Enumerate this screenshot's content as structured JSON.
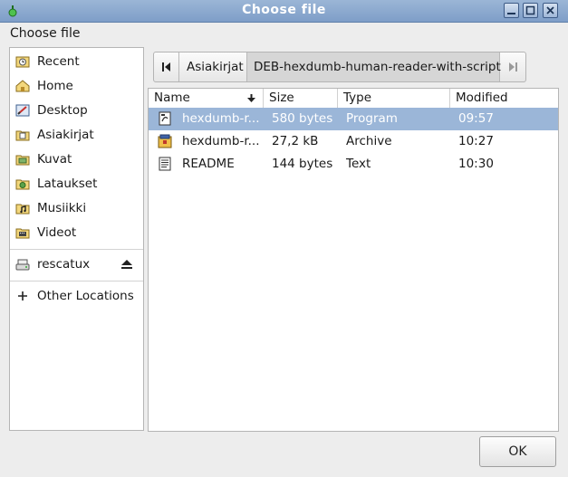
{
  "window": {
    "title": "Choose file"
  },
  "dialog": {
    "header": "Choose file",
    "ok_label": "OK"
  },
  "sidebar": {
    "places": [
      {
        "label": "Recent",
        "icon": "recent-icon"
      },
      {
        "label": "Home",
        "icon": "home-folder-icon"
      },
      {
        "label": "Desktop",
        "icon": "desktop-icon"
      },
      {
        "label": "Asiakirjat",
        "icon": "documents-folder-icon"
      },
      {
        "label": "Kuvat",
        "icon": "pictures-folder-icon"
      },
      {
        "label": "Lataukset",
        "icon": "downloads-folder-icon"
      },
      {
        "label": "Musiikki",
        "icon": "music-folder-icon"
      },
      {
        "label": "Videot",
        "icon": "videos-folder-icon"
      }
    ],
    "devices": [
      {
        "label": "rescatux",
        "icon": "drive-icon"
      }
    ],
    "other_locations": "Other Locations"
  },
  "pathbar": {
    "segments": [
      "Asiakirjat",
      "DEB-hexdumb-human-reader-with-script"
    ]
  },
  "filelist": {
    "columns": [
      "Name",
      "Size",
      "Type",
      "Modified"
    ],
    "sort_column": "Name",
    "rows": [
      {
        "name": "hexdumb-r...",
        "size": "580 bytes",
        "type": "Program",
        "modified": "09:57",
        "icon": "script-file-icon",
        "selected": true
      },
      {
        "name": "hexdumb-r...",
        "size": "27,2 kB",
        "type": "Archive",
        "modified": "10:27",
        "icon": "package-file-icon",
        "selected": false
      },
      {
        "name": "README",
        "size": "144 bytes",
        "type": "Text",
        "modified": "10:30",
        "icon": "text-file-icon",
        "selected": false
      }
    ]
  },
  "colors": {
    "titlebar": "#8aa7cf",
    "selection": "#9bb6d8"
  }
}
